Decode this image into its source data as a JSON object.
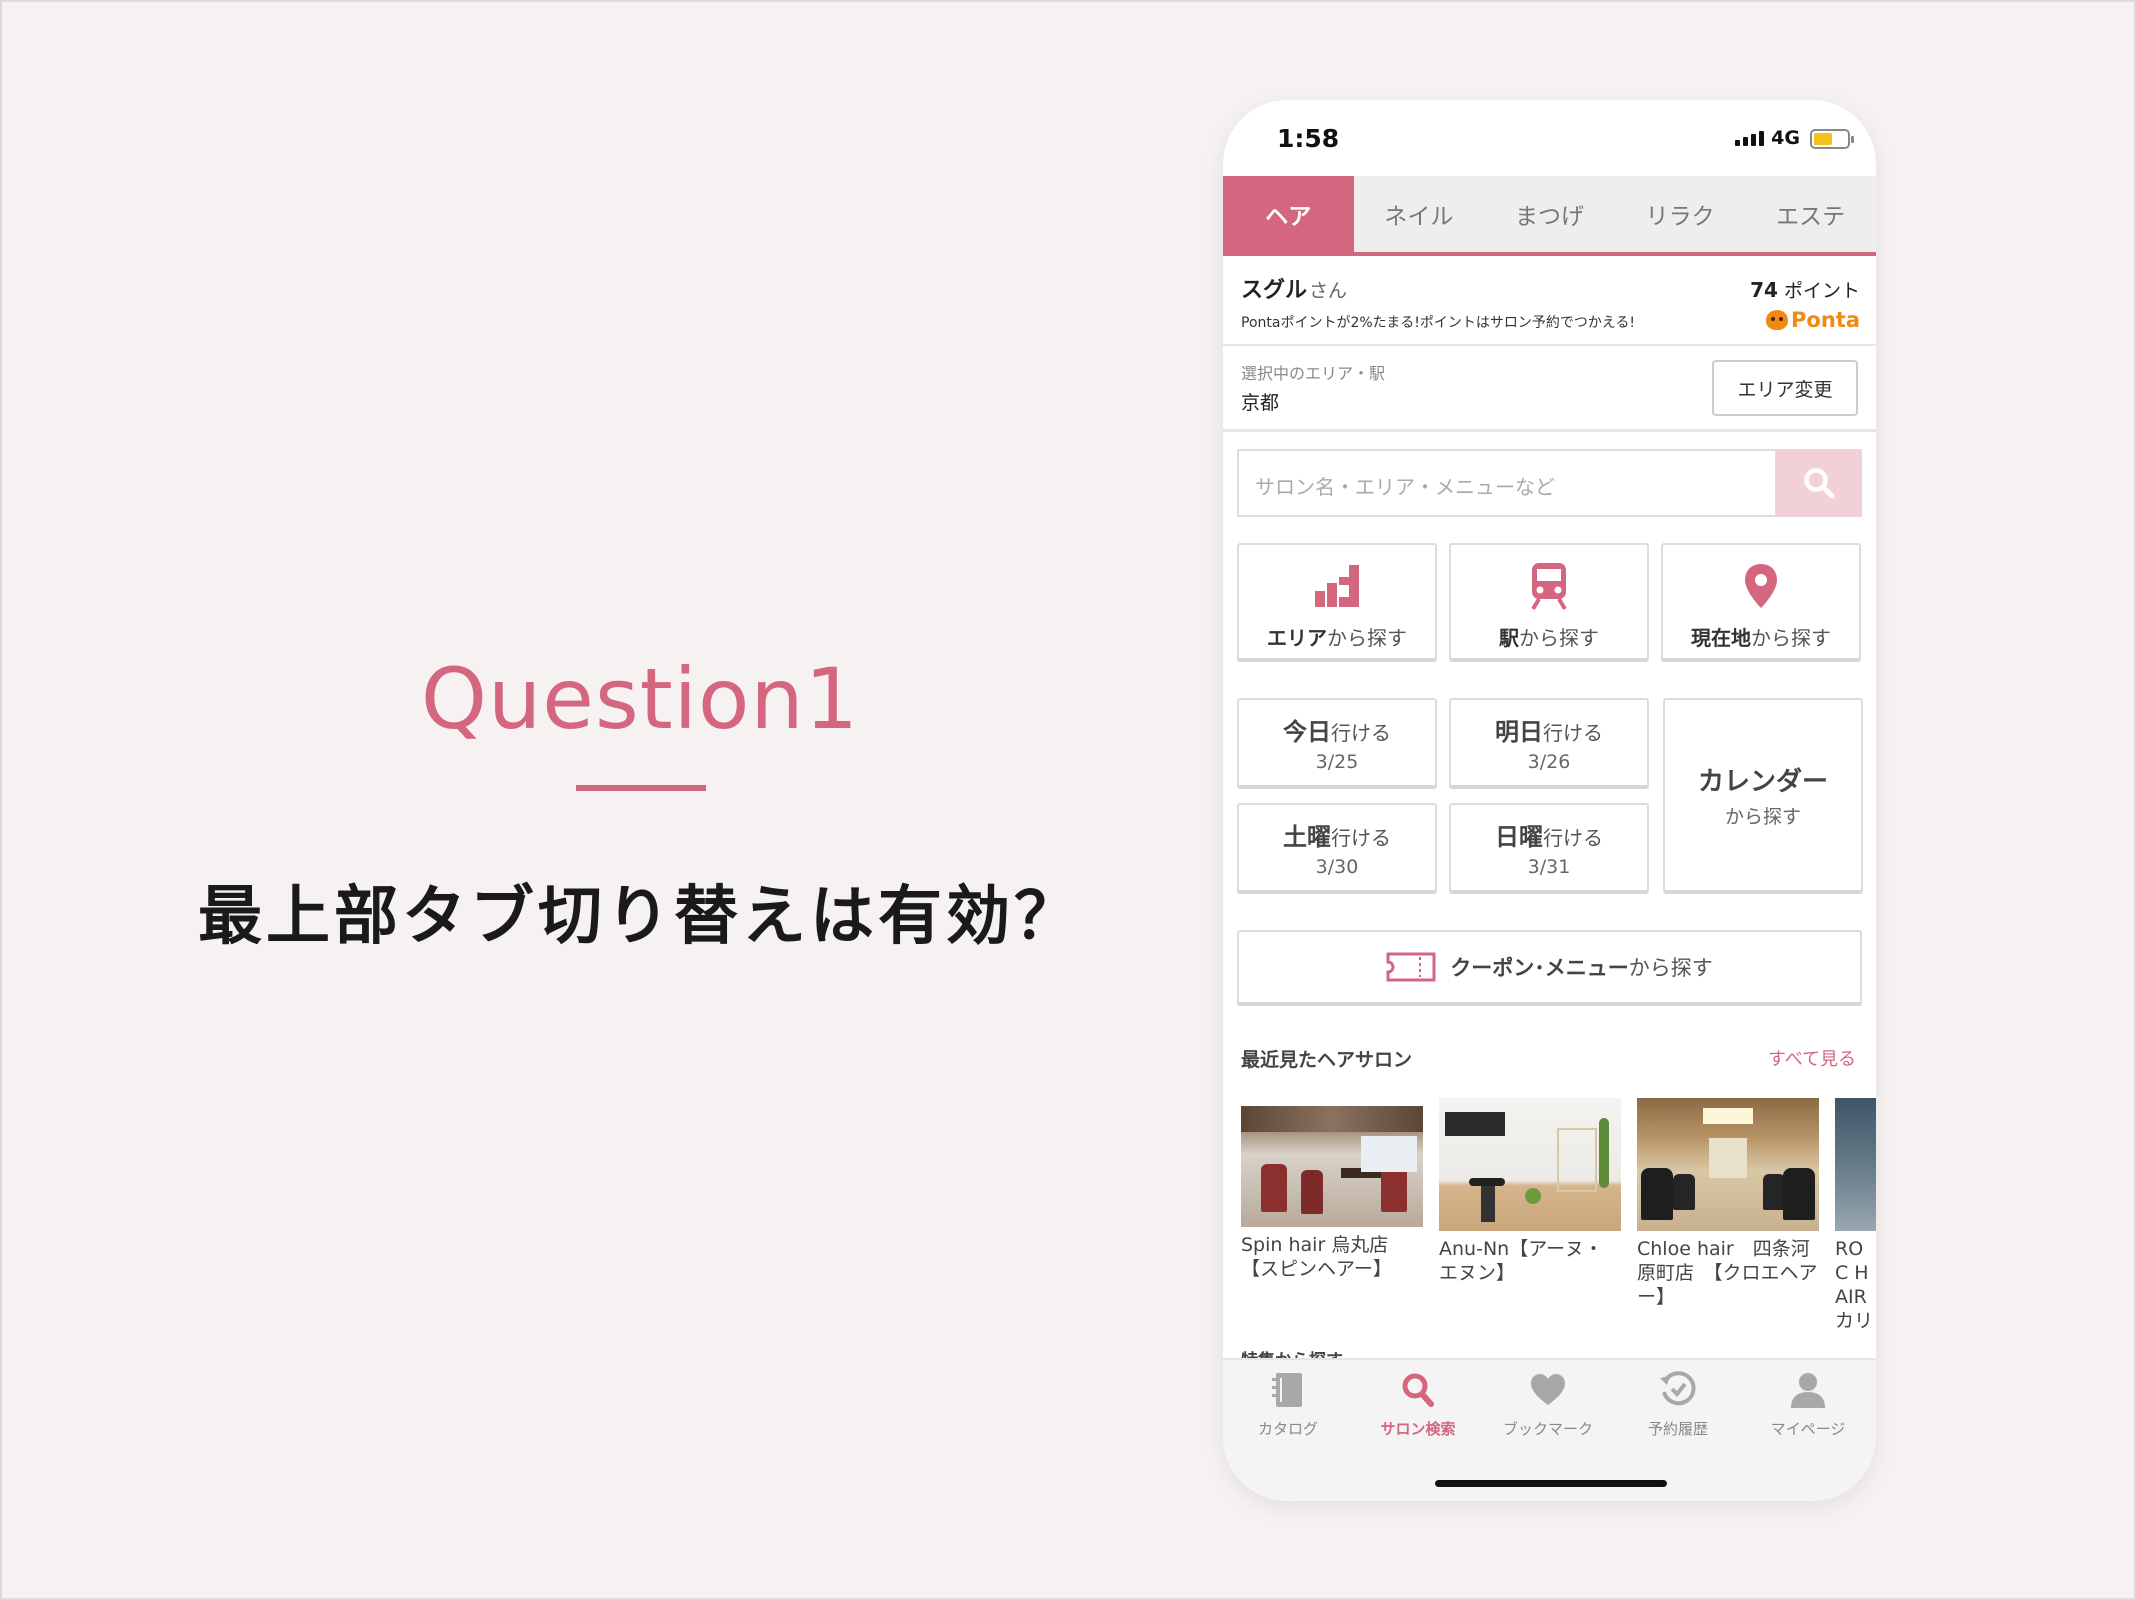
{
  "slide": {
    "title": "Question1",
    "question": "最上部タブ切り替えは有効？",
    "accent_color": "#d4667f"
  },
  "status_bar": {
    "time": "1:58",
    "network": "4G",
    "icons": [
      "signal-icon",
      "battery-icon"
    ]
  },
  "tabs": [
    {
      "label": "ヘア",
      "active": true
    },
    {
      "label": "ネイル",
      "active": false
    },
    {
      "label": "まつげ",
      "active": false
    },
    {
      "label": "リラク",
      "active": false
    },
    {
      "label": "エステ",
      "active": false
    }
  ],
  "user": {
    "name": "スグル",
    "honorific": "さん",
    "points_value": "74",
    "points_unit": "ポイント",
    "promo": "Pontaポイントが2%たまる!ポイントはサロン予約でつかえる!",
    "ponta_logo": "Ponta"
  },
  "area": {
    "label": "選択中のエリア・駅",
    "value": "京都",
    "change_button": "エリア変更"
  },
  "search": {
    "placeholder": "サロン名・エリア・メニューなど",
    "icon": "search-icon"
  },
  "find_by": [
    {
      "bold": "エリア",
      "rest": "から探す",
      "icon": "area-icon"
    },
    {
      "bold": "駅",
      "rest": "から探す",
      "icon": "train-icon"
    },
    {
      "bold": "現在地",
      "rest": "から探す",
      "icon": "location-pin-icon"
    }
  ],
  "days": [
    {
      "bold": "今日",
      "rest": "行ける",
      "date": "3/25"
    },
    {
      "bold": "明日",
      "rest": "行ける",
      "date": "3/26"
    },
    {
      "bold": "土曜",
      "rest": "行ける",
      "date": "3/30"
    },
    {
      "bold": "日曜",
      "rest": "行ける",
      "date": "3/31"
    }
  ],
  "calendar": {
    "title": "カレンダー",
    "sub": "から探す"
  },
  "coupon": {
    "bold": "クーポン･メニュー",
    "rest": "から探す",
    "icon": "coupon-ticket-icon"
  },
  "recent": {
    "heading": "最近見たヘアサロン",
    "see_all": "すべて見る",
    "salons": [
      {
        "name": "Spin hair 烏丸店【スピンヘアー】"
      },
      {
        "name": "Anu-Nn【アーヌ・エヌン】"
      },
      {
        "name": "Chloe hair　四条河原町店　【クロエヘアー】"
      },
      {
        "name": "ROC HAIR カリ"
      }
    ]
  },
  "section_peek": "特集から探す",
  "bottom_nav": [
    {
      "label": "カタログ",
      "icon": "catalog-icon",
      "active": false
    },
    {
      "label": "サロン検索",
      "icon": "search-icon",
      "active": true
    },
    {
      "label": "ブックマーク",
      "icon": "heart-icon",
      "active": false
    },
    {
      "label": "予約履歴",
      "icon": "history-icon",
      "active": false
    },
    {
      "label": "マイページ",
      "icon": "person-icon",
      "active": false
    }
  ]
}
